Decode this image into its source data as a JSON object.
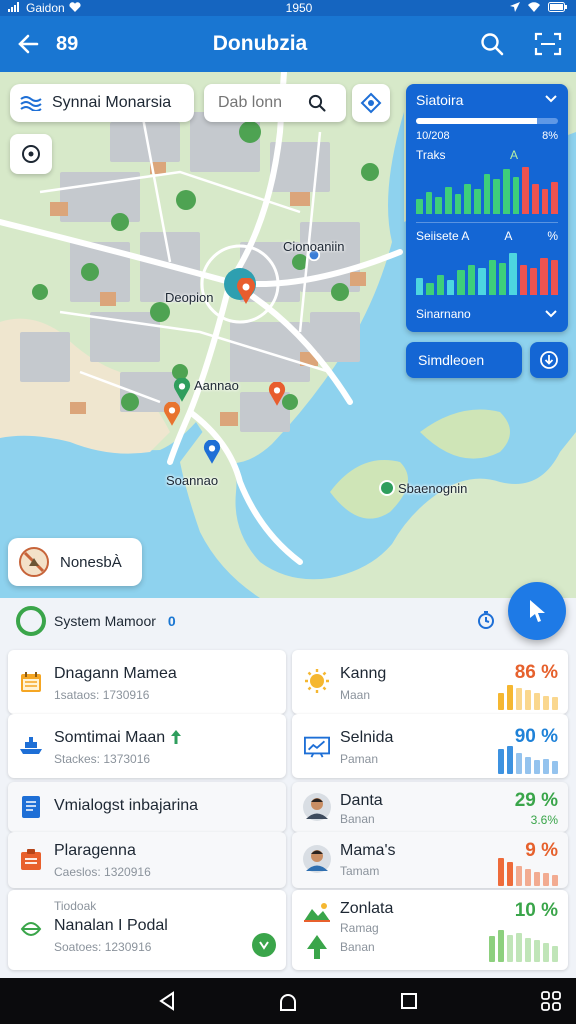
{
  "status_bar": {
    "carrier": "Gaidon",
    "time": "1950"
  },
  "app_bar": {
    "badge": "89",
    "title": "Donubzia"
  },
  "map": {
    "search_pill_label": "Synnai Monarsia",
    "search_placeholder": "Dab lonn",
    "labels": {
      "north": "Cionoaniin",
      "west": "Deopion",
      "center": "Aannao",
      "south": "Soannao",
      "east": "Sbaenognin"
    },
    "notice_label": "NonesbÀ"
  },
  "stats_panel": {
    "title": "Siatoira",
    "progress": 0.85,
    "row_left": "10/208",
    "row_right": "8%",
    "section1_label": "Traks",
    "section1_mark": "A",
    "section2_label": "Seiisete A",
    "section2_mark": "A",
    "section2_right": "%",
    "footer_label": "Sinarnano",
    "bars1": [
      0.3,
      0.45,
      0.35,
      0.55,
      0.4,
      0.6,
      0.5,
      0.8,
      0.7,
      0.9,
      0.75,
      0.95,
      0.6,
      0.5,
      0.65
    ],
    "bars2": [
      0.35,
      0.25,
      0.4,
      0.3,
      0.5,
      0.6,
      0.55,
      0.7,
      0.65,
      0.85,
      0.6,
      0.55,
      0.75,
      0.7
    ],
    "colors": {
      "green": "#3ecf7a",
      "teal": "#4dd6e0",
      "red": "#ef5350"
    }
  },
  "simulation_button": "Simdleoen",
  "sheet": {
    "header_label": "System Mamoor",
    "header_count": "0"
  },
  "left_cards": [
    {
      "title": "Dnagann Mamea",
      "subtitle": "1sataos: 1730916",
      "icon": "calendar-icon"
    },
    {
      "title": "Somtimai Maan",
      "subtitle": "Stackes: 1373016",
      "icon": "ship-icon"
    },
    {
      "title": "Vmialogst inbajarina",
      "subtitle": "",
      "icon": "document-icon"
    },
    {
      "title": "Plaragenna",
      "subtitle": "Caeslos: 1320916",
      "icon": "clipboard-icon"
    },
    {
      "title": "Nanalan I Podal",
      "subtitle": "Soatoes: 1230916",
      "overline": "Tiodoak",
      "icon": "leaf-icon"
    }
  ],
  "right_cards": [
    {
      "title": "Kanng",
      "subtitle": "Maan",
      "percent": "86 %",
      "color": "#e6612d",
      "bar_color": "#f5b731",
      "bars": [
        0.6,
        0.9,
        0.8,
        0.7,
        0.6,
        0.5,
        0.45
      ],
      "icon": "sun-icon"
    },
    {
      "title": "Selnida",
      "subtitle": "Paman",
      "percent": "90 %",
      "color": "#1f82d8",
      "bar_color": "#3d92e0",
      "bars": [
        0.9,
        1.0,
        0.75,
        0.6,
        0.5,
        0.55,
        0.45
      ],
      "icon": "chart-board-icon"
    },
    {
      "title": "Danta",
      "subtitle": "Banan",
      "percent": "29 %",
      "sub_percent": "3.6%",
      "color": "#3aa54a",
      "icon": "avatar-icon"
    },
    {
      "title": "Mama's",
      "subtitle": "Tamam",
      "percent": "9 %",
      "color": "#e6612d",
      "bar_color": "#ee6b3a",
      "bars": [
        1.0,
        0.85,
        0.7,
        0.6,
        0.5,
        0.45,
        0.4
      ],
      "icon": "avatar-icon"
    },
    {
      "title": "Zonlata",
      "subtitle": "Ramag",
      "extra": "Banan",
      "percent": "10 %",
      "color": "#3aa54a",
      "bar_color": "#8dd07e",
      "bars": [
        0.8,
        1.0,
        0.85,
        0.9,
        0.75,
        0.7,
        0.6,
        0.5
      ],
      "icon": "tree-icon"
    }
  ]
}
